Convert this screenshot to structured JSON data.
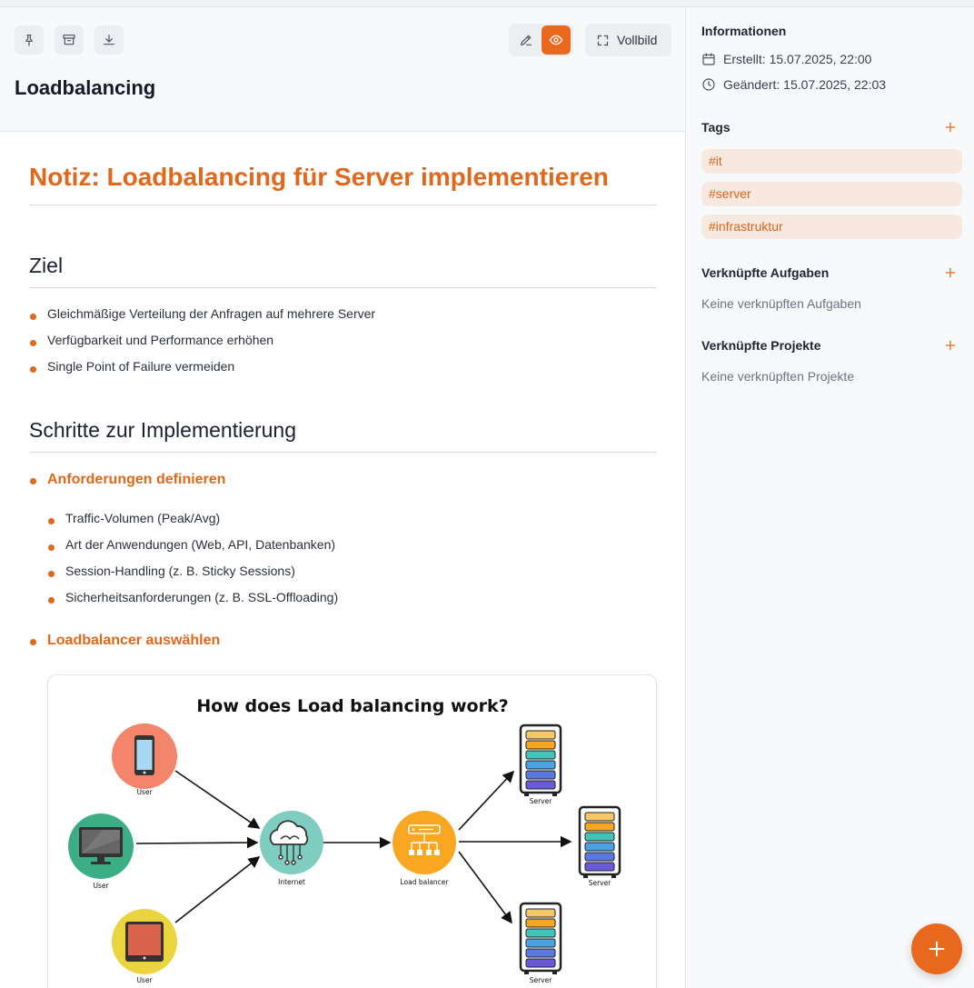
{
  "header": {
    "title": "Loadbalancing",
    "fullscreen_label": "Vollbild"
  },
  "note": {
    "heading": "Notiz: Loadbalancing für Server implementieren",
    "sections": [
      {
        "heading": "Ziel",
        "items": [
          "Gleichmäßige Verteilung der Anfragen auf mehrere Server",
          "Verfügbarkeit und Performance erhöhen",
          "Single Point of Failure vermeiden"
        ]
      },
      {
        "heading": "Schritte zur Implementierung",
        "steps": [
          {
            "label": "Anforderungen definieren",
            "items": [
              "Traffic-Volumen (Peak/Avg)",
              "Art der Anwendungen (Web, API, Datenbanken)",
              "Session-Handling (z. B. Sticky Sessions)",
              "Sicherheitsanforderungen (z. B. SSL-Offloading)"
            ]
          },
          {
            "label": "Loadbalancer auswählen"
          }
        ]
      }
    ],
    "diagram": {
      "title": "How does Load balancing work?",
      "labels": {
        "user1": "User",
        "user2": "User",
        "user3": "User",
        "internet": "Internet",
        "lb": "Load balancer",
        "server1": "Server",
        "server2": "Server",
        "server3": "Server"
      }
    }
  },
  "sidebar": {
    "info_heading": "Informationen",
    "created": "Erstellt: 15.07.2025, 22:00",
    "modified": "Geändert: 15.07.2025, 22:03",
    "tags_heading": "Tags",
    "tags": [
      "#it",
      "#server",
      "#infrastruktur"
    ],
    "tasks_heading": "Verknüpfte Aufgaben",
    "tasks_empty": "Keine verknüpften Aufgaben",
    "projects_heading": "Verknüpfte Projekte",
    "projects_empty": "Keine verknüpften Projekte"
  },
  "colors": {
    "accent": "#e8691d",
    "tag_bg": "#f7e9df"
  }
}
